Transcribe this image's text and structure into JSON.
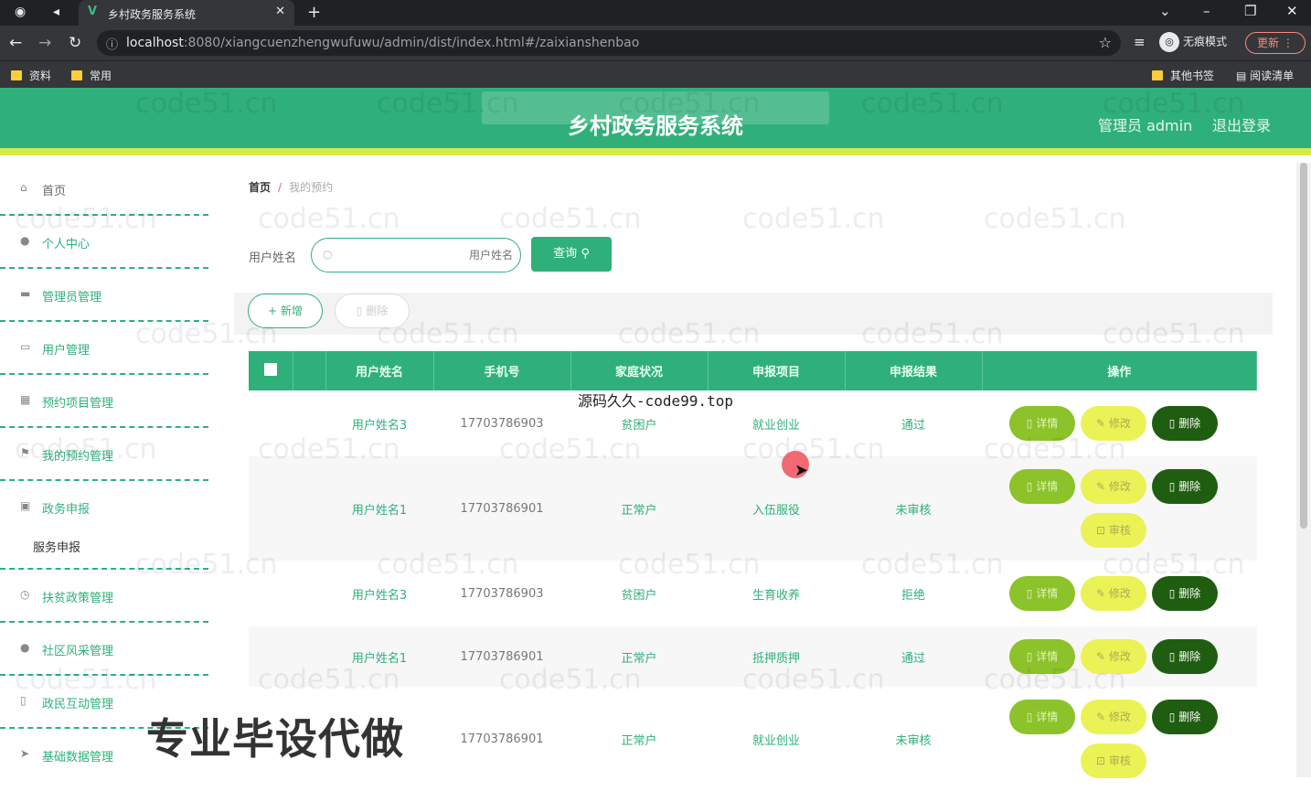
{
  "browser": {
    "tab_title": "乡村政务服务系统",
    "url_host": "localhost",
    "url_path": ":8080/xiangcuenzhengwufuwu/admin/dist/index.html#/zaixianshenbao",
    "incognito_label": "无痕模式",
    "update_label": "更新",
    "bookmarks": [
      "资料",
      "常用"
    ],
    "other_bookmarks": "其他书签",
    "reading_list": "阅读清单"
  },
  "header": {
    "title": "乡村政务服务系统",
    "admin_label": "管理员 admin",
    "logout_label": "退出登录",
    "accent": "#2fb07a",
    "stripe": "#d4ea4a"
  },
  "sidebar": {
    "items": [
      {
        "label": "首页",
        "icon": "home-icon"
      },
      {
        "label": "个人中心",
        "icon": "user-icon"
      },
      {
        "label": "管理员管理",
        "icon": "admin-icon"
      },
      {
        "label": "用户管理",
        "icon": "users-icon"
      },
      {
        "label": "预约项目管理",
        "icon": "grid-icon"
      },
      {
        "label": "我的预约管理",
        "icon": "flag-icon"
      },
      {
        "label": "政务申报",
        "icon": "chat-icon"
      },
      {
        "label": "扶贫政策管理",
        "icon": "clock-icon"
      },
      {
        "label": "社区风采管理",
        "icon": "user-icon"
      },
      {
        "label": "政民互动管理",
        "icon": "book-icon"
      },
      {
        "label": "基础数据管理",
        "icon": "send-icon"
      }
    ],
    "subheading": "服务申报"
  },
  "main": {
    "breadcrumb_home": "首页",
    "breadcrumb_sep": "/",
    "breadcrumb_current": "我的预约",
    "search_label": "用户姓名",
    "search_placeholder": "用户姓名",
    "query_button": "查询",
    "add_button": "新增",
    "delete_button": "删除",
    "columns": [
      "用户姓名",
      "手机号",
      "家庭状况",
      "申报项目",
      "申报结果",
      "操作"
    ],
    "rows": [
      {
        "name": "用户姓名3",
        "phone": "17703786903",
        "family": "贫困户",
        "project": "就业创业",
        "result": "通过",
        "audit": false
      },
      {
        "name": "用户姓名1",
        "phone": "17703786901",
        "family": "正常户",
        "project": "入伍服役",
        "result": "未审核",
        "audit": true
      },
      {
        "name": "用户姓名3",
        "phone": "17703786903",
        "family": "贫困户",
        "project": "生育收养",
        "result": "拒绝",
        "audit": false
      },
      {
        "name": "用户姓名1",
        "phone": "17703786901",
        "family": "正常户",
        "project": "抵押质押",
        "result": "通过",
        "audit": false
      },
      {
        "name": "",
        "phone": "17703786901",
        "family": "正常户",
        "project": "就业创业",
        "result": "未审核",
        "audit": true
      }
    ],
    "op_detail": "详情",
    "op_edit": "修改",
    "op_delete": "删除",
    "op_audit": "审核"
  },
  "watermark": {
    "grid_text": "code51.cn",
    "center_text": "源码久久-code99.top",
    "bottom_text": "专业毕设代做"
  }
}
